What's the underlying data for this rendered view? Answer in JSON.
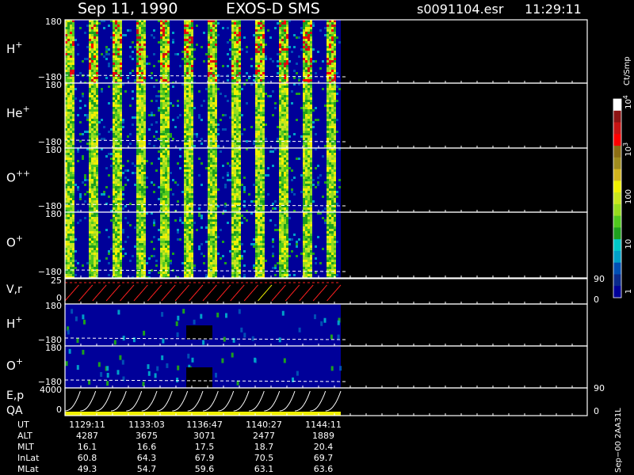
{
  "header": {
    "date": "Sep 11, 1990",
    "instrument": "EXOS-D SMS",
    "file": "s0091104.esr",
    "time": "11:29:11"
  },
  "colorbar": {
    "unit": "Ct/Smp",
    "ticks": [
      {
        "label": "1",
        "value": 1
      },
      {
        "label": "10",
        "value": 10
      },
      {
        "label": "100",
        "value": 100
      },
      {
        "label": "10",
        "sup": "3",
        "value": 1000
      },
      {
        "label": "10",
        "sup": "4",
        "value": 10000
      }
    ],
    "colors": [
      "#000099",
      "#0a2a8c",
      "#0050b4",
      "#00a0c8",
      "#00c8c8",
      "#1ea01e",
      "#50c81e",
      "#96dc1e",
      "#c8e61e",
      "#f0f000",
      "#d2b41e",
      "#a08c1e",
      "#8c6e14",
      "#ff0000",
      "#c81414",
      "#8c1414",
      "#ffffff"
    ]
  },
  "chart_data": [
    {
      "type": "heatmap",
      "panel": "H+",
      "label": "H",
      "sup": "+",
      "ylim": [
        -180,
        180
      ],
      "ytick_top": "180",
      "ytick_bottom": "−180"
    },
    {
      "type": "heatmap",
      "panel": "He+",
      "label": "He",
      "sup": "+",
      "ylim": [
        -180,
        180
      ],
      "ytick_top": "180",
      "ytick_bottom": "−180"
    },
    {
      "type": "heatmap",
      "panel": "O++",
      "label": "O",
      "sup": "++",
      "ylim": [
        -180,
        180
      ],
      "ytick_top": "180",
      "ytick_bottom": "−180"
    },
    {
      "type": "heatmap",
      "panel": "O+",
      "label": "O",
      "sup": "+",
      "ylim": [
        -180,
        180
      ],
      "ytick_top": "180",
      "ytick_bottom": "−180"
    },
    {
      "type": "line",
      "panel": "V,r",
      "label": "V,r",
      "ylim": [
        0,
        25
      ],
      "ytick_top": "25",
      "ytick_bottom": "0",
      "right_ticks": [
        "90",
        "0"
      ],
      "right_ylim": [
        0,
        90
      ],
      "sweeps": 20
    },
    {
      "type": "heatmap",
      "panel": "H+ (2)",
      "label": "H",
      "sup": "+",
      "ylim": [
        -180,
        180
      ],
      "ytick_top": "180",
      "ytick_bottom": "−180"
    },
    {
      "type": "heatmap",
      "panel": "O+ (2)",
      "label": "O",
      "sup": "+",
      "ylim": [
        -180,
        180
      ],
      "ytick_top": "180",
      "ytick_bottom": "−180"
    },
    {
      "type": "line",
      "panel": "E,p QA",
      "label": "E,p",
      "label2": "QA",
      "ylim": [
        0,
        4000
      ],
      "ytick_top": "4000",
      "ytick_bottom": "0",
      "right_ticks": [
        "90",
        "0"
      ],
      "right_ylim": [
        0,
        90
      ],
      "sweeps": 18
    }
  ],
  "footer": {
    "rows": [
      {
        "name": "UT",
        "values": [
          "1129:11",
          "1133:03",
          "1136:47",
          "1140:27",
          "1144:11"
        ]
      },
      {
        "name": "ALT",
        "values": [
          "4287",
          "3675",
          "3071",
          "2477",
          "1889"
        ]
      },
      {
        "name": "MLT",
        "values": [
          "16.1",
          "16.6",
          "17.5",
          "18.7",
          "20.4"
        ]
      },
      {
        "name": "InLat",
        "values": [
          "60.8",
          "64.3",
          "67.9",
          "70.5",
          "69.7"
        ]
      },
      {
        "name": "MLat",
        "values": [
          "49.3",
          "54.7",
          "59.6",
          "63.1",
          "63.6"
        ]
      }
    ],
    "version": "Sep−00 2AA31L"
  }
}
